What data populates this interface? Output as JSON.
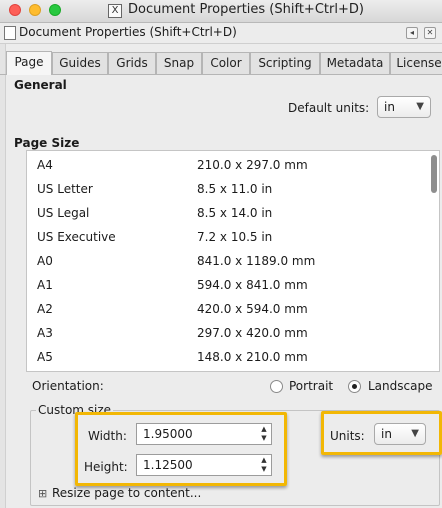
{
  "window": {
    "title": "Document Properties (Shift+Ctrl+D)",
    "app_icon": "X"
  },
  "dock": {
    "title": "Document Properties (Shift+Ctrl+D)",
    "arrow": "◂",
    "close": "✕"
  },
  "tabs": [
    {
      "label": "Page",
      "active": true
    },
    {
      "label": "Guides"
    },
    {
      "label": "Grids"
    },
    {
      "label": "Snap"
    },
    {
      "label": "Color"
    },
    {
      "label": "Scripting"
    },
    {
      "label": "Metadata"
    },
    {
      "label": "License"
    }
  ],
  "general": {
    "heading": "General",
    "default_units_label": "Default units:",
    "default_units_value": "in"
  },
  "page_size": {
    "heading": "Page Size",
    "rows": [
      {
        "name": "A4",
        "dims": "210.0 x 297.0 mm"
      },
      {
        "name": "US Letter",
        "dims": "8.5 x 11.0 in"
      },
      {
        "name": "US Legal",
        "dims": "8.5 x 14.0 in"
      },
      {
        "name": "US Executive",
        "dims": "7.2 x 10.5 in"
      },
      {
        "name": "A0",
        "dims": "841.0 x 1189.0 mm"
      },
      {
        "name": "A1",
        "dims": "594.0 x 841.0 mm"
      },
      {
        "name": "A2",
        "dims": "420.0 x 594.0 mm"
      },
      {
        "name": "A3",
        "dims": "297.0 x 420.0 mm"
      },
      {
        "name": "A5",
        "dims": "148.0 x 210.0 mm"
      }
    ]
  },
  "orientation": {
    "label": "Orientation:",
    "portrait": "Portrait",
    "landscape": "Landscape",
    "selected": "Landscape"
  },
  "custom_size": {
    "legend": "Custom size",
    "width_label": "Width:",
    "width_value": "1.95000",
    "height_label": "Height:",
    "height_value": "1.12500",
    "units_label": "Units:",
    "units_value": "in",
    "resize_label": "Resize page to content...",
    "resize_icon": "⊞"
  },
  "colors": {
    "highlight": "#f2b705",
    "list_bg": "#ffffff",
    "window_bg": "#ececec"
  }
}
